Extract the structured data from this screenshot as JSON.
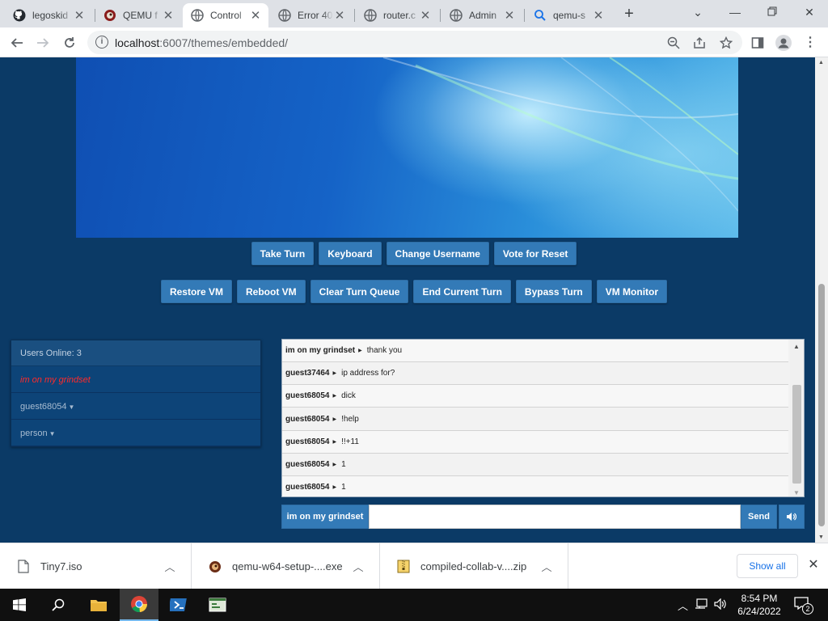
{
  "browser": {
    "tabs": [
      {
        "label": "legoskid",
        "icon": "github-icon",
        "active": false
      },
      {
        "label": "QEMU f",
        "icon": "qemu-icon",
        "active": false
      },
      {
        "label": "Control",
        "icon": "globe-icon",
        "active": true
      },
      {
        "label": "Error 40",
        "icon": "globe-icon",
        "active": false
      },
      {
        "label": "router.c",
        "icon": "globe-icon",
        "active": false
      },
      {
        "label": "Admin",
        "icon": "globe-icon",
        "active": false
      },
      {
        "label": "qemu-s",
        "icon": "search-icon",
        "active": false
      }
    ],
    "url_host": "localhost",
    "url_path": ":6007/themes/embedded/"
  },
  "vm_controls": {
    "row1": [
      "Take Turn",
      "Keyboard",
      "Change Username",
      "Vote for Reset"
    ],
    "row2": [
      "Restore VM",
      "Reboot VM",
      "Clear Turn Queue",
      "End Current Turn",
      "Bypass Turn",
      "VM Monitor"
    ]
  },
  "users": {
    "header": "Users Online: 3",
    "list": [
      {
        "name": "im on my grindset",
        "self": true,
        "caret": false
      },
      {
        "name": "guest68054",
        "self": false,
        "caret": true
      },
      {
        "name": "person",
        "self": false,
        "caret": true
      }
    ]
  },
  "chat": {
    "messages": [
      {
        "user": "im on my grindset",
        "text": "thank you"
      },
      {
        "user": "guest37464",
        "text": "ip address for?"
      },
      {
        "user": "guest68054",
        "text": "dick"
      },
      {
        "user": "guest68054",
        "text": "!help"
      },
      {
        "user": "guest68054",
        "text": "!!+11"
      },
      {
        "user": "guest68054",
        "text": "1"
      },
      {
        "user": "guest68054",
        "text": "1"
      }
    ],
    "username_button": "im on my grindset",
    "input_value": "",
    "send_label": "Send"
  },
  "downloads": {
    "items": [
      {
        "name": "Tiny7.iso",
        "icon": "file-icon"
      },
      {
        "name": "qemu-w64-setup-....exe",
        "icon": "qemu-icon"
      },
      {
        "name": "compiled-collab-v....zip",
        "icon": "zip-icon"
      }
    ],
    "show_all": "Show all"
  },
  "taskbar": {
    "time": "8:54 PM",
    "date": "6/24/2022",
    "notifications": "2"
  },
  "colors": {
    "page_bg": "#0b3a66",
    "button_blue": "#337ab7",
    "self_user": "#ff2a2a"
  }
}
